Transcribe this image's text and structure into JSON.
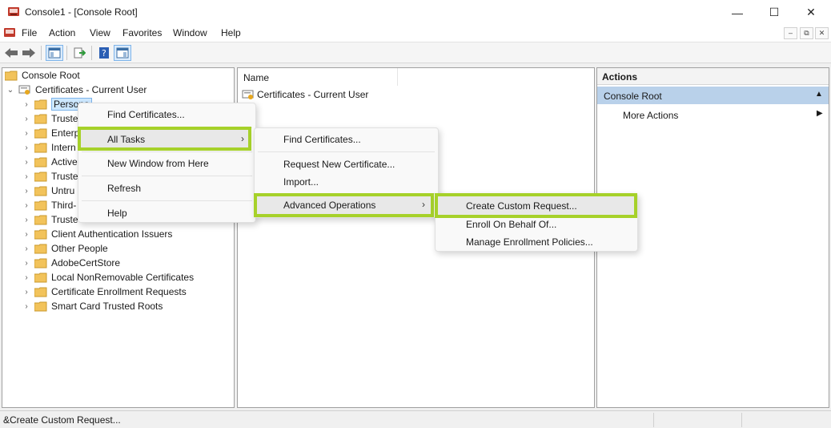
{
  "window": {
    "title": "Console1 - [Console Root]",
    "minimize": "—",
    "maximize": "☐",
    "close": "✕"
  },
  "menubar": {
    "items": [
      "File",
      "Action",
      "View",
      "Favorites",
      "Window",
      "Help"
    ],
    "mdi_min": "–",
    "mdi_restore": "⧉",
    "mdi_close": "✕"
  },
  "tree": {
    "root": "Console Root",
    "snapin": "Certificates - Current User",
    "stores": [
      "Persona",
      "Truste",
      "Enterp",
      "Intern",
      "Active",
      "Truste",
      "Untru",
      "Third-",
      "Truste",
      "Client Authentication Issuers",
      "Other People",
      "AdobeCertStore",
      "Local NonRemovable Certificates",
      "Certificate Enrollment Requests",
      "Smart Card Trusted Roots"
    ]
  },
  "list": {
    "column_name": "Name",
    "rows": [
      "Certificates - Current User"
    ]
  },
  "actions": {
    "header": "Actions",
    "section": "Console Root",
    "more": "More Actions"
  },
  "context_menu": {
    "items": [
      "Find Certificates...",
      "All Tasks",
      "New Window from Here",
      "Refresh",
      "Help"
    ]
  },
  "all_tasks_menu": {
    "items": [
      "Find Certificates...",
      "Request New Certificate...",
      "Import...",
      "Advanced Operations"
    ]
  },
  "advanced_menu": {
    "items": [
      "Create Custom Request...",
      "Enroll On Behalf Of...",
      "Manage Enrollment Policies..."
    ]
  },
  "status": {
    "text": "&Create Custom Request..."
  },
  "colors": {
    "highlight": "#a6d12a",
    "selection": "#cde8ff",
    "actions_section": "#b9d1ea"
  }
}
